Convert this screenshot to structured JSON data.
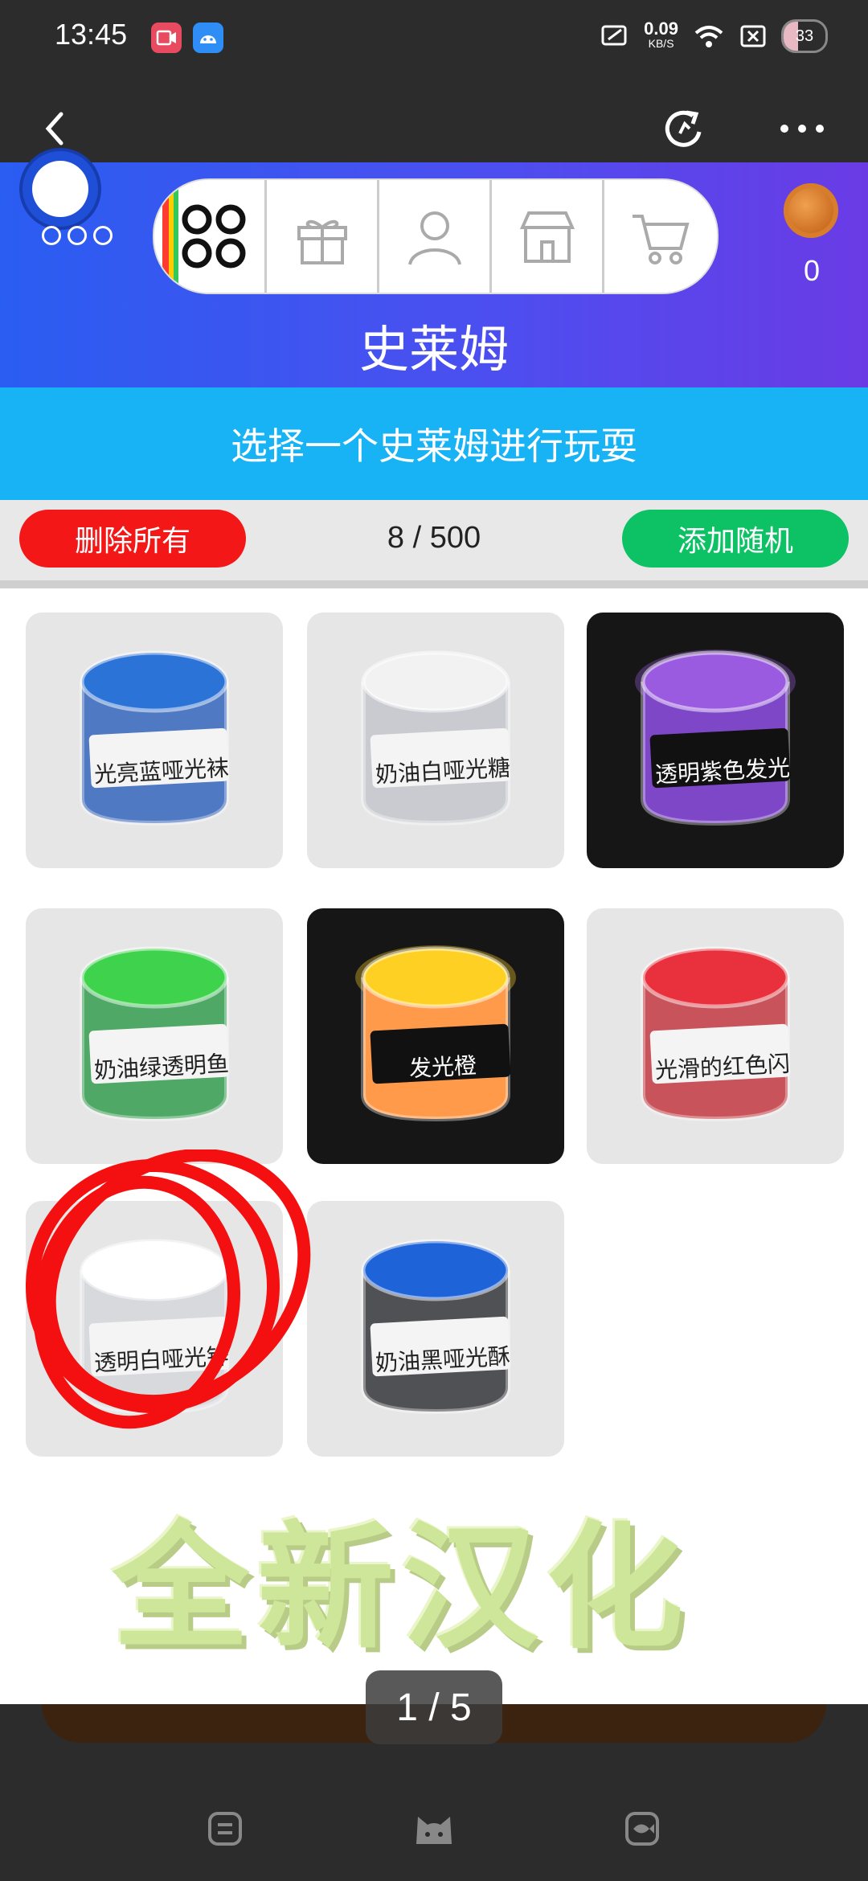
{
  "status_bar": {
    "time": "13:45",
    "net_speed_value": "0.09",
    "net_speed_unit": "KB/S",
    "battery": "33"
  },
  "game": {
    "coin_count": "0",
    "title": "史莱姆",
    "subtitle": "选择一个史莱姆进行玩耍",
    "delete_all_label": "删除所有",
    "add_random_label": "添加随机",
    "count": "8 / 500"
  },
  "slimes": [
    {
      "label": "光亮蓝哑光袜",
      "body": "#4f79c2",
      "top": "#2c73d8",
      "dark": false
    },
    {
      "label": "奶油白哑光糖",
      "body": "#c9cbd0",
      "top": "#f2f2f2",
      "dark": false
    },
    {
      "label": "透明紫色发光",
      "body": "#7e47c8",
      "top": "#9b5be0",
      "dark": true
    },
    {
      "label": "奶油绿透明鱼",
      "body": "#4fa866",
      "top": "#3fd24c",
      "dark": false
    },
    {
      "label": "发光橙",
      "body": "#ff9a4a",
      "top": "#ffd024",
      "dark": true
    },
    {
      "label": "光滑的红色闪",
      "body": "#c9535a",
      "top": "#e8313c",
      "dark": false
    },
    {
      "label": "透明白哑光锌",
      "body": "#d7d9dd",
      "top": "#ffffff",
      "dark": false
    },
    {
      "label": "奶油黑哑光酥",
      "body": "#505155",
      "top": "#1e63d8",
      "dark": false
    }
  ],
  "promo_text": "全新汉化",
  "page_indicator": "1 / 5"
}
